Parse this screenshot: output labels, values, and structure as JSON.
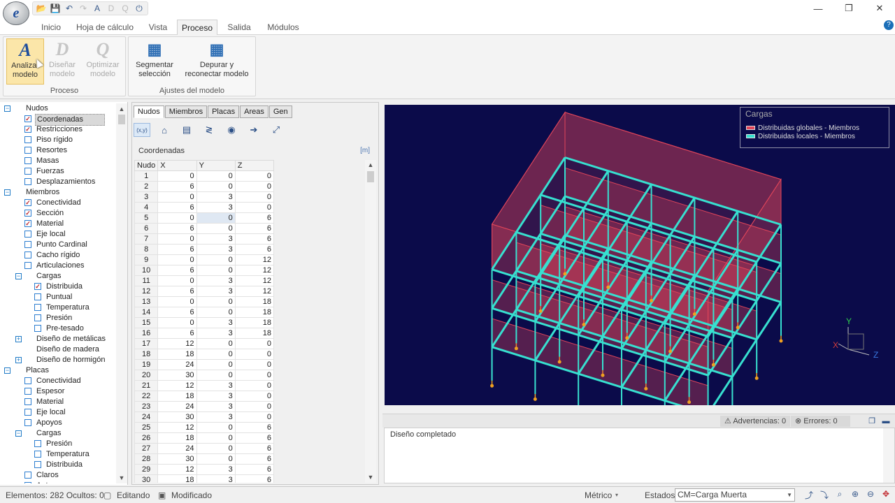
{
  "app": {
    "logo_letter": "e"
  },
  "quick_access": [
    {
      "name": "open-icon",
      "glyph": "📂"
    },
    {
      "name": "save-icon",
      "glyph": "💾"
    },
    {
      "name": "undo-icon",
      "glyph": "↶"
    },
    {
      "name": "redo-icon",
      "glyph": "↷"
    },
    {
      "name": "analyze-icon",
      "glyph": "A"
    },
    {
      "name": "design-icon",
      "glyph": "D"
    },
    {
      "name": "optimize-icon",
      "glyph": "Q"
    },
    {
      "name": "power-icon",
      "glyph": "⏻"
    }
  ],
  "window_controls": {
    "minimize": "—",
    "maximize": "❐",
    "close": "✕"
  },
  "menu_tabs": [
    "Inicio",
    "Hoja de cálculo",
    "Vista",
    "Proceso",
    "Salida",
    "Módulos"
  ],
  "active_menu_tab": "Proceso",
  "help_glyph": "?",
  "ribbon": {
    "groups": [
      {
        "label": "Proceso",
        "buttons": [
          {
            "line1": "Analizar",
            "line2": "modelo",
            "icon_letter": "A",
            "enabled": true,
            "highlighted": true
          },
          {
            "line1": "Diseñar",
            "line2": "modelo",
            "icon_letter": "D",
            "enabled": false
          },
          {
            "line1": "Optimizar",
            "line2": "modelo",
            "icon_letter": "Q",
            "enabled": false
          }
        ]
      },
      {
        "label": "Ajustes del modelo",
        "buttons": [
          {
            "line1": "Segmentar",
            "line2": "selección",
            "icon_letter": "▦",
            "enabled": true
          },
          {
            "line1": "Depurar y",
            "line2": "reconectar modelo",
            "icon_letter": "▦",
            "enabled": true
          }
        ]
      }
    ]
  },
  "tree": [
    {
      "label": "Nudos",
      "level": 0,
      "expander": "−"
    },
    {
      "label": "Coordenadas",
      "level": 1,
      "checked": true,
      "selected": true
    },
    {
      "label": "Restricciones",
      "level": 1,
      "checked": true
    },
    {
      "label": "Piso rígido",
      "level": 1,
      "checked": false
    },
    {
      "label": "Resortes",
      "level": 1,
      "checked": false
    },
    {
      "label": "Masas",
      "level": 1,
      "checked": false
    },
    {
      "label": "Fuerzas",
      "level": 1,
      "checked": false
    },
    {
      "label": "Desplazamientos",
      "level": 1,
      "checked": false
    },
    {
      "label": "Miembros",
      "level": 0,
      "expander": "−"
    },
    {
      "label": "Conectividad",
      "level": 1,
      "checked": true
    },
    {
      "label": "Sección",
      "level": 1,
      "checked": true
    },
    {
      "label": "Material",
      "level": 1,
      "checked": true
    },
    {
      "label": "Eje local",
      "level": 1,
      "checked": false
    },
    {
      "label": "Punto Cardinal",
      "level": 1,
      "checked": false
    },
    {
      "label": "Cacho rígido",
      "level": 1,
      "checked": false
    },
    {
      "label": "Articulaciones",
      "level": 1,
      "checked": false
    },
    {
      "label": "Cargas",
      "level": 1,
      "expander": "−"
    },
    {
      "label": "Distribuida",
      "level": 2,
      "checked": true
    },
    {
      "label": "Puntual",
      "level": 2,
      "checked": false
    },
    {
      "label": "Temperatura",
      "level": 2,
      "checked": false
    },
    {
      "label": "Presión",
      "level": 2,
      "checked": false
    },
    {
      "label": "Pre-tesado",
      "level": 2,
      "checked": false
    },
    {
      "label": "Diseño de metálicas",
      "level": 1,
      "expander": "+"
    },
    {
      "label": "Diseño de madera",
      "level": 1
    },
    {
      "label": "Diseño de hormigón",
      "level": 1,
      "expander": "+"
    },
    {
      "label": "Placas",
      "level": 0,
      "expander": "−"
    },
    {
      "label": "Conectividad",
      "level": 1,
      "checked": false
    },
    {
      "label": "Espesor",
      "level": 1,
      "checked": false
    },
    {
      "label": "Material",
      "level": 1,
      "checked": false
    },
    {
      "label": "Eje local",
      "level": 1,
      "checked": false
    },
    {
      "label": "Apoyos",
      "level": 1,
      "checked": false
    },
    {
      "label": "Cargas",
      "level": 1,
      "expander": "−"
    },
    {
      "label": "Presión",
      "level": 2,
      "checked": false
    },
    {
      "label": "Temperatura",
      "level": 2,
      "checked": false
    },
    {
      "label": "Distribuida",
      "level": 2,
      "checked": false
    },
    {
      "label": "Claros",
      "level": 1,
      "checked": false
    },
    {
      "label": "Ant...",
      "level": 1,
      "checked": false
    }
  ],
  "sheet_tabs": [
    "Nudos",
    "Miembros",
    "Placas",
    "Areas",
    "Gen"
  ],
  "active_sheet_tab": "Nudos",
  "sheet_tools": [
    {
      "name": "coordinates-tool-icon",
      "glyph": "(x,y)"
    },
    {
      "name": "supports-tool-icon",
      "glyph": "⌂"
    },
    {
      "name": "rigid-floor-tool-icon",
      "glyph": "▤"
    },
    {
      "name": "springs-tool-icon",
      "glyph": "≷"
    },
    {
      "name": "masses-tool-icon",
      "glyph": "◉"
    },
    {
      "name": "forces-tool-icon",
      "glyph": "➔"
    },
    {
      "name": "displacements-tool-icon",
      "glyph": "⤢"
    }
  ],
  "sheet": {
    "title": "Coordenadas",
    "unit": "[m]",
    "columns": [
      "Nudo",
      "X",
      "Y",
      "Z"
    ],
    "rows": [
      [
        1,
        0,
        0,
        0
      ],
      [
        2,
        6,
        0,
        0
      ],
      [
        3,
        0,
        3,
        0
      ],
      [
        4,
        6,
        3,
        0
      ],
      [
        5,
        0,
        0,
        6
      ],
      [
        6,
        6,
        0,
        6
      ],
      [
        7,
        0,
        3,
        6
      ],
      [
        8,
        6,
        3,
        6
      ],
      [
        9,
        0,
        0,
        12
      ],
      [
        10,
        6,
        0,
        12
      ],
      [
        11,
        0,
        3,
        12
      ],
      [
        12,
        6,
        3,
        12
      ],
      [
        13,
        0,
        0,
        18
      ],
      [
        14,
        6,
        0,
        18
      ],
      [
        15,
        0,
        3,
        18
      ],
      [
        16,
        6,
        3,
        18
      ],
      [
        17,
        12,
        0,
        0
      ],
      [
        18,
        18,
        0,
        0
      ],
      [
        19,
        24,
        0,
        0
      ],
      [
        20,
        30,
        0,
        0
      ],
      [
        21,
        12,
        3,
        0
      ],
      [
        22,
        18,
        3,
        0
      ],
      [
        23,
        24,
        3,
        0
      ],
      [
        24,
        30,
        3,
        0
      ],
      [
        25,
        12,
        0,
        6
      ],
      [
        26,
        18,
        0,
        6
      ],
      [
        27,
        24,
        0,
        6
      ],
      [
        28,
        30,
        0,
        6
      ],
      [
        29,
        12,
        3,
        6
      ],
      [
        30,
        18,
        3,
        6
      ]
    ]
  },
  "viewport": {
    "legend_title": "Cargas",
    "legend_items": [
      {
        "label": "Distribuidas globales - Miembros",
        "color": "#e0455a"
      },
      {
        "label": "Distribuidas locales - Miembros",
        "color": "#37e0d0"
      }
    ],
    "axis_labels": {
      "x": "X",
      "y": "Y",
      "z": "Z"
    },
    "background": "#0b0b4a",
    "frame_color": "#f0a020",
    "global_color": "#e0455a",
    "local_color": "#37e0d0"
  },
  "output": {
    "warnings": "Advertencias: 0",
    "errors": "Errores: 0",
    "message": "Diseño completado"
  },
  "statusbar": {
    "elements": "Elementos: 282 Ocultos: 0",
    "editing": "Editando",
    "modified": "Modificado",
    "units": "Métrico",
    "states_label": "Estados:",
    "state_value": "CM=Carga Muerta"
  }
}
